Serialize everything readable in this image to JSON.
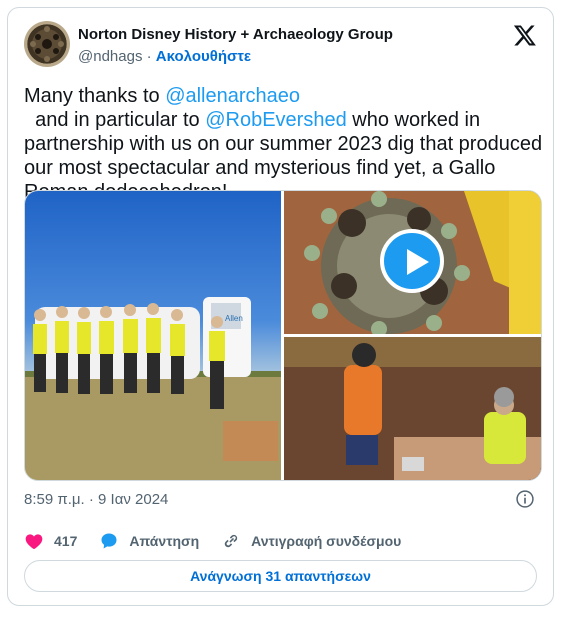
{
  "author": {
    "name": "Norton Disney History + Archaeology Group",
    "handle": "@ndhags",
    "separator": "·",
    "follow_label": "Ακολουθήστε"
  },
  "tweet": {
    "text_1": "Many thanks to ",
    "mention_1": "@allenarchaeo",
    "text_2": "  and in particular to ",
    "mention_2": "@RobEvershed",
    "text_3": " who worked in partnership with us on our summer 2023 dig that produced our most spectacular and mysterious find yet, a Gallo Roman dodecahedron!"
  },
  "media": {
    "images": [
      {
        "name": "team-photo"
      },
      {
        "name": "dodecahedron-video"
      },
      {
        "name": "excavation-photo"
      }
    ],
    "van_text": "Allen"
  },
  "meta": {
    "timestamp": "8:59 π.μ. · 9 Ιαν 2024"
  },
  "actions": {
    "likes_count": "417",
    "reply_label": "Απάντηση",
    "copy_link_label": "Αντιγραφή συνδέσμου"
  },
  "read_replies_label": "Ανάγνωση 31 απαντήσεων",
  "colors": {
    "accent": "#1d9bf0",
    "link": "#006fd6",
    "like": "#f91880",
    "muted": "#536471",
    "border": "#cfd9de"
  }
}
